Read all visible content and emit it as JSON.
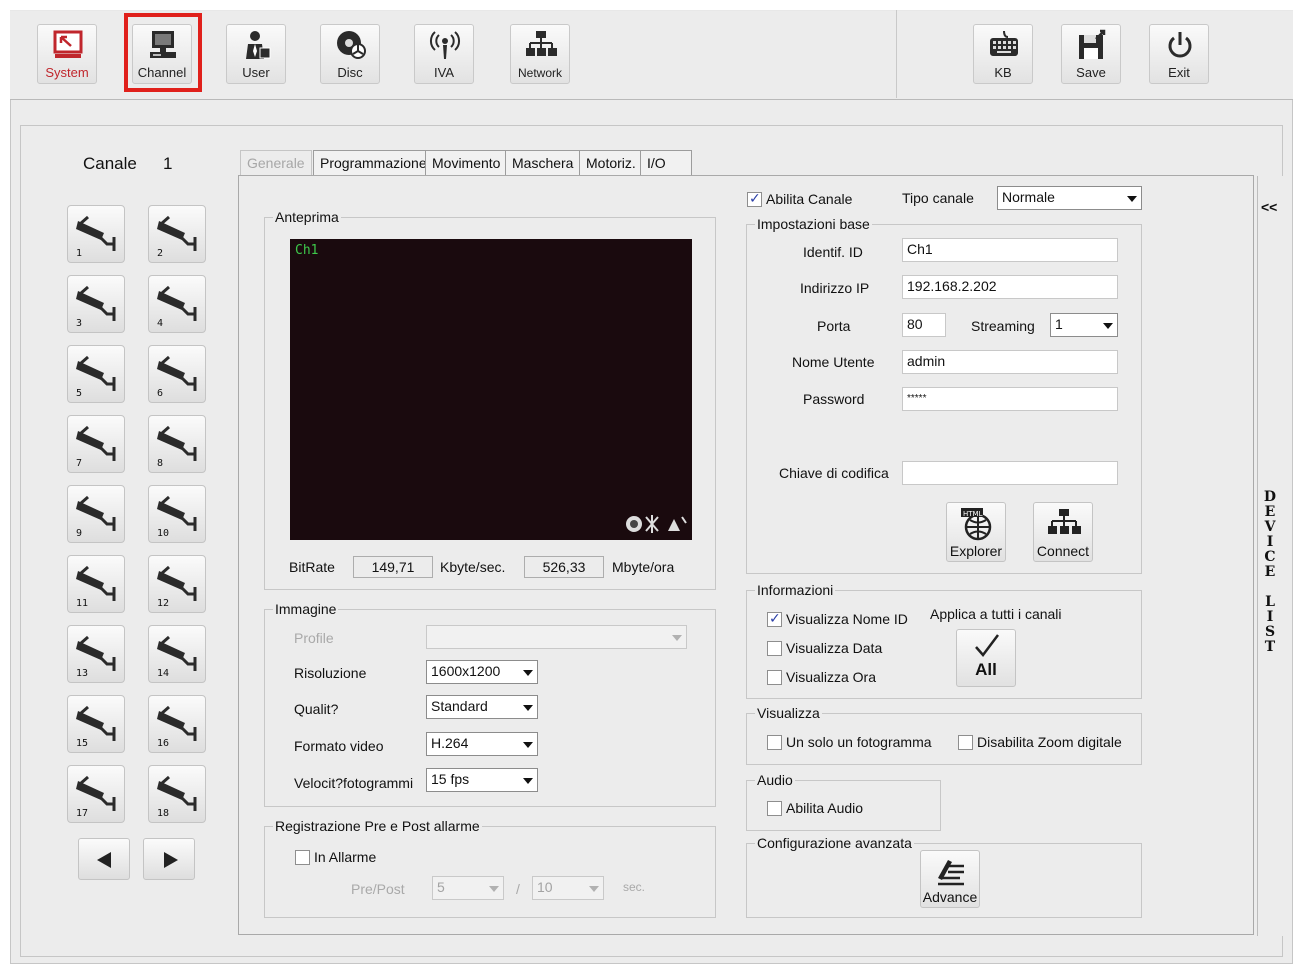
{
  "toolbar": {
    "buttons": [
      {
        "label": "System",
        "icon": "system-icon"
      },
      {
        "label": "Channel",
        "icon": "channel-icon"
      },
      {
        "label": "User",
        "icon": "user-icon"
      },
      {
        "label": "Disc",
        "icon": "disc-icon"
      },
      {
        "label": "IVA",
        "icon": "iva-icon"
      },
      {
        "label": "Network",
        "icon": "network-icon"
      },
      {
        "label": "KB",
        "icon": "keyboard-icon"
      },
      {
        "label": "Save",
        "icon": "save-icon"
      },
      {
        "label": "Exit",
        "icon": "power-icon"
      }
    ],
    "selected": "Channel"
  },
  "sidebar": {
    "canale_label": "Canale",
    "canale_value": "1",
    "cameras": [
      "1",
      "2",
      "3",
      "4",
      "5",
      "6",
      "7",
      "8",
      "9",
      "10",
      "11",
      "12",
      "13",
      "14",
      "15",
      "16",
      "17",
      "18"
    ]
  },
  "tabs": [
    "Generale",
    "Programmazione",
    "Movimento",
    "Maschera",
    "Motoriz.",
    "I/O"
  ],
  "active_tab": "Generale",
  "device_list": {
    "collapse": "<<",
    "label": "DEVICE LIST"
  },
  "preview": {
    "group_title": "Anteprima",
    "overlay": "Ch1",
    "bitrate_label": "BitRate",
    "bitrate_value": "149,71",
    "bitrate_unit": "Kbyte/sec.",
    "size_value": "526,33",
    "size_unit": "Mbyte/ora"
  },
  "image": {
    "group_title": "Immagine",
    "profile_label": "Profile",
    "profile_value": "",
    "resolution_label": "Risoluzione",
    "resolution_value": "1600x1200",
    "quality_label": "Qualit?",
    "quality_value": "Standard",
    "format_label": "Formato video",
    "format_value": "H.264",
    "fps_label": "Velocit?fotogrammi",
    "fps_value": "15 fps"
  },
  "prepost": {
    "group_title": "Registrazione Pre e Post allarme",
    "in_alarm_label": "In Allarme",
    "prepost_label": "Pre/Post",
    "pre_value": "5",
    "separator": "/",
    "post_value": "10",
    "unit": "sec."
  },
  "enable_channel": {
    "label": "Abilita Canale",
    "checked": true
  },
  "channel_type": {
    "label": "Tipo canale",
    "value": "Normale"
  },
  "base": {
    "group_title": "Impostazioni base",
    "id_label": "Identif. ID",
    "id_value": "Ch1",
    "ip_label": "Indirizzo IP",
    "ip_value": "192.168.2.202",
    "port_label": "Porta",
    "port_value": "80",
    "streaming_label": "Streaming",
    "streaming_value": "1",
    "user_label": "Nome Utente",
    "user_value": "admin",
    "password_label": "Password",
    "password_value": "*****",
    "key_label": "Chiave di codifica",
    "key_value": "",
    "explorer_label": "Explorer",
    "connect_label": "Connect"
  },
  "info": {
    "group_title": "Informazioni",
    "show_name_label": "Visualizza Nome ID",
    "show_date_label": "Visualizza Data",
    "show_time_label": "Visualizza Ora",
    "apply_all_label": "Applica a tutti i canali",
    "all_button": "All"
  },
  "view": {
    "group_title": "Visualizza",
    "single_frame_label": "Un solo un fotogramma",
    "disable_zoom_label": "Disabilita Zoom digitale"
  },
  "audio": {
    "group_title": "Audio",
    "enable_label": "Abilita Audio"
  },
  "advanced": {
    "group_title": "Configurazione avanzata",
    "button_label": "Advance"
  }
}
